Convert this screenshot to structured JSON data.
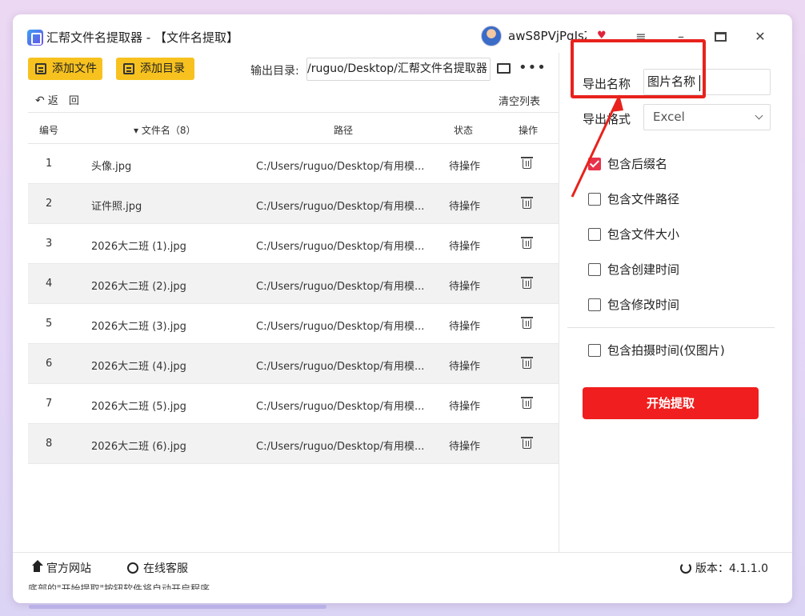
{
  "titlebar": {
    "title": "汇帮文件名提取器 - 【文件名提取】",
    "username": "awS8PVjPqIsZ",
    "minimize_icon": "minimize-icon",
    "maximize_icon": "maximize-icon",
    "close_icon": "close-icon",
    "menu_icon": "menu-icon"
  },
  "toolbar": {
    "add_file": "添加文件",
    "add_dir": "添加目录",
    "output_label": "输出目录:",
    "output_path": "/ruguo/Desktop/汇帮文件名提取器",
    "back_label": "返　回",
    "clear_label": "清空列表"
  },
  "table": {
    "headers": {
      "num": "编号",
      "name": "▾ 文件名（8）",
      "path": "路径",
      "status": "状态",
      "action": "操作"
    },
    "rows": [
      {
        "num": "1",
        "name": "头像.jpg",
        "path": "C:/Users/ruguo/Desktop/有用模...",
        "status": "待操作"
      },
      {
        "num": "2",
        "name": "证件照.jpg",
        "path": "C:/Users/ruguo/Desktop/有用模...",
        "status": "待操作"
      },
      {
        "num": "3",
        "name": "2026大二班 (1).jpg",
        "path": "C:/Users/ruguo/Desktop/有用模...",
        "status": "待操作"
      },
      {
        "num": "4",
        "name": "2026大二班 (2).jpg",
        "path": "C:/Users/ruguo/Desktop/有用模...",
        "status": "待操作"
      },
      {
        "num": "5",
        "name": "2026大二班 (3).jpg",
        "path": "C:/Users/ruguo/Desktop/有用模...",
        "status": "待操作"
      },
      {
        "num": "6",
        "name": "2026大二班 (4).jpg",
        "path": "C:/Users/ruguo/Desktop/有用模...",
        "status": "待操作"
      },
      {
        "num": "7",
        "name": "2026大二班 (5).jpg",
        "path": "C:/Users/ruguo/Desktop/有用模...",
        "status": "待操作"
      },
      {
        "num": "8",
        "name": "2026大二班 (6).jpg",
        "path": "C:/Users/ruguo/Desktop/有用模...",
        "status": "待操作"
      }
    ]
  },
  "settings": {
    "export_name_label": "导出名称",
    "export_name_value": "图片名称",
    "export_format_label": "导出格式",
    "export_format_value": "Excel",
    "options": [
      {
        "label": "包含后缀名",
        "checked": true
      },
      {
        "label": "包含文件路径",
        "checked": false
      },
      {
        "label": "包含文件大小",
        "checked": false
      },
      {
        "label": "包含创建时间",
        "checked": false
      },
      {
        "label": "包含修改时间",
        "checked": false
      }
    ],
    "photo_time_label": "包含拍摄时间(仅图片)",
    "start_button": "开始提取"
  },
  "footer": {
    "website": "官方网站",
    "service": "在线客服",
    "version": "版本：4.1.1.0",
    "hint": "底部的\"开始提取\"按钮软件将自动开启程序"
  },
  "colors": {
    "accent_yellow": "#f7c21f",
    "start_red": "#f01e1e",
    "checkbox_red": "#e8324a",
    "annotation_red": "#e8221c"
  }
}
